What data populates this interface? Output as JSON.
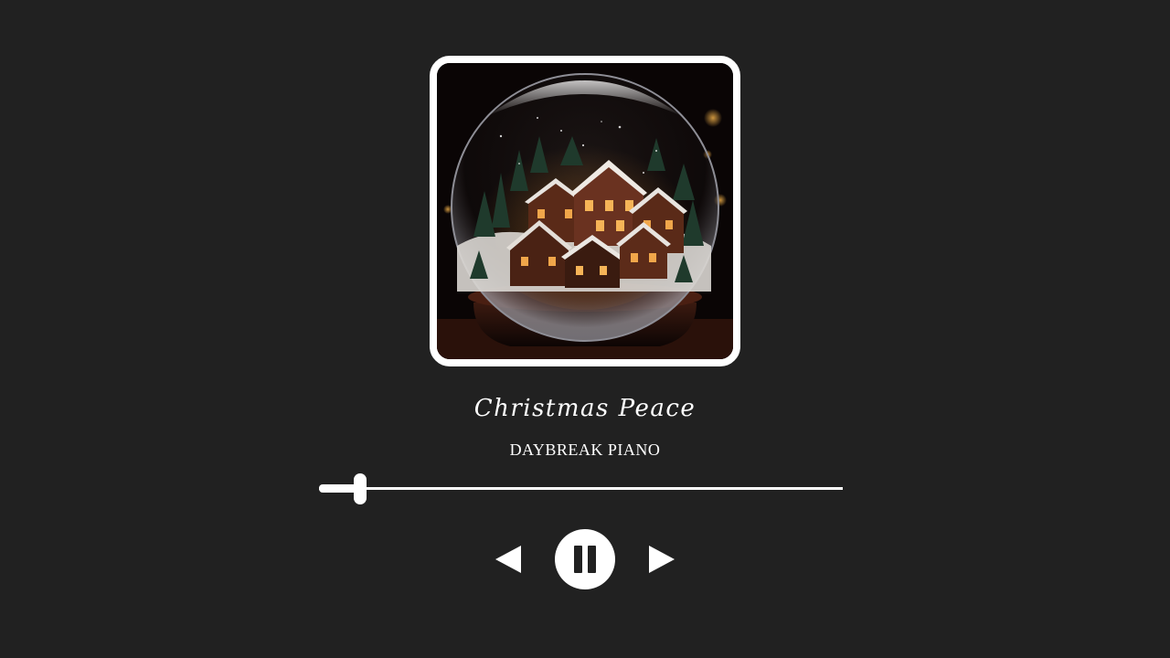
{
  "track": {
    "title": "Christmas Peace",
    "artist": "DAYBREAK PIANO"
  },
  "playback": {
    "state": "playing",
    "progress": 0.079
  },
  "controls": {
    "previous_icon": "previous-triangle-icon",
    "pause_icon": "pause-icon",
    "next_icon": "next-triangle-icon"
  },
  "cover": {
    "subject": "snow globe village"
  },
  "colors": {
    "background": "#212121",
    "foreground": "#ffffff"
  }
}
